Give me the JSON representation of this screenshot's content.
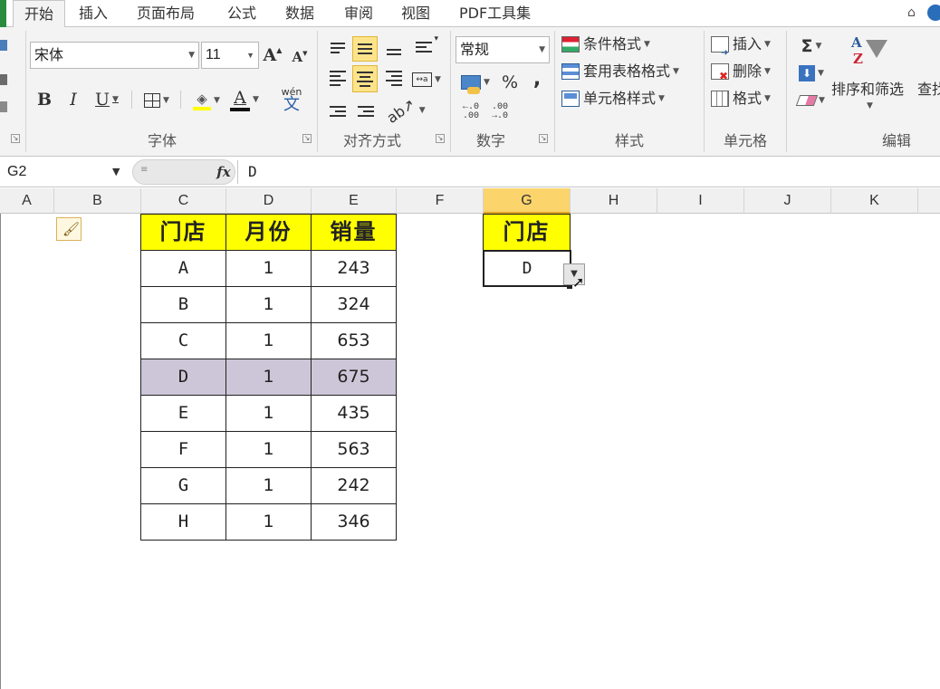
{
  "tabs": [
    {
      "label": "开始",
      "active": true
    },
    {
      "label": "插入"
    },
    {
      "label": "页面布局"
    },
    {
      "label": "公式"
    },
    {
      "label": "数据"
    },
    {
      "label": "审阅"
    },
    {
      "label": "视图"
    },
    {
      "label": "PDF工具集"
    }
  ],
  "font": {
    "name": "宋体",
    "size": "11",
    "bold": "B",
    "italic": "I",
    "underline": "U",
    "increase": "A",
    "decrease": "A",
    "wen": "wén",
    "font_color_letter": "A"
  },
  "number": {
    "format": "常规",
    "percent": "%",
    "comma": ","
  },
  "styles": {
    "conditional": "条件格式",
    "table": "套用表格格式",
    "cell": "单元格样式"
  },
  "cells": {
    "insert": "插入",
    "delete": "删除",
    "format": "格式"
  },
  "editing": {
    "sum": "Σ",
    "sort_filter": "排序和筛选",
    "find": "查找"
  },
  "groups": {
    "font": "字体",
    "align": "对齐方式",
    "number": "数字",
    "styles": "样式",
    "cells": "单元格",
    "editing": "编辑"
  },
  "formula_bar": {
    "name_box": "G2",
    "fx": "fx",
    "content": "D"
  },
  "columns": [
    "A",
    "B",
    "C",
    "D",
    "E",
    "F",
    "G",
    "H",
    "I",
    "J",
    "K"
  ],
  "selected_column": "G",
  "table": {
    "headers": [
      "门店",
      "月份",
      "销量"
    ],
    "rows": [
      [
        "A",
        "1",
        "243"
      ],
      [
        "B",
        "1",
        "324"
      ],
      [
        "C",
        "1",
        "653"
      ],
      [
        "D",
        "1",
        "675"
      ],
      [
        "E",
        "1",
        "435"
      ],
      [
        "F",
        "1",
        "563"
      ],
      [
        "G",
        "1",
        "242"
      ],
      [
        "H",
        "1",
        "346"
      ]
    ],
    "highlight_row": 3
  },
  "lookup": {
    "header": "门店",
    "value": "D"
  },
  "colors": {
    "header_fill": "#ffff00",
    "highlight_fill": "#cdc6d8",
    "selected_col": "#fbd46b"
  }
}
